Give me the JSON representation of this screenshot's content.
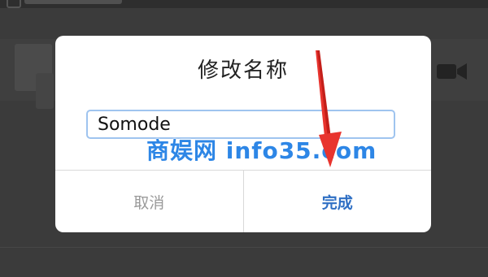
{
  "dialog": {
    "title": "修改名称",
    "name_value": "Somode",
    "cancel_label": "取消",
    "done_label": "完成"
  },
  "watermark": "商娱网 info35.com",
  "colors": {
    "overlay": "#3b3b3b",
    "accent": "#2f6fc4",
    "watermark": "#2d86e6",
    "arrow": "#e8342e"
  },
  "icons": {
    "video": "video-camera-icon"
  }
}
